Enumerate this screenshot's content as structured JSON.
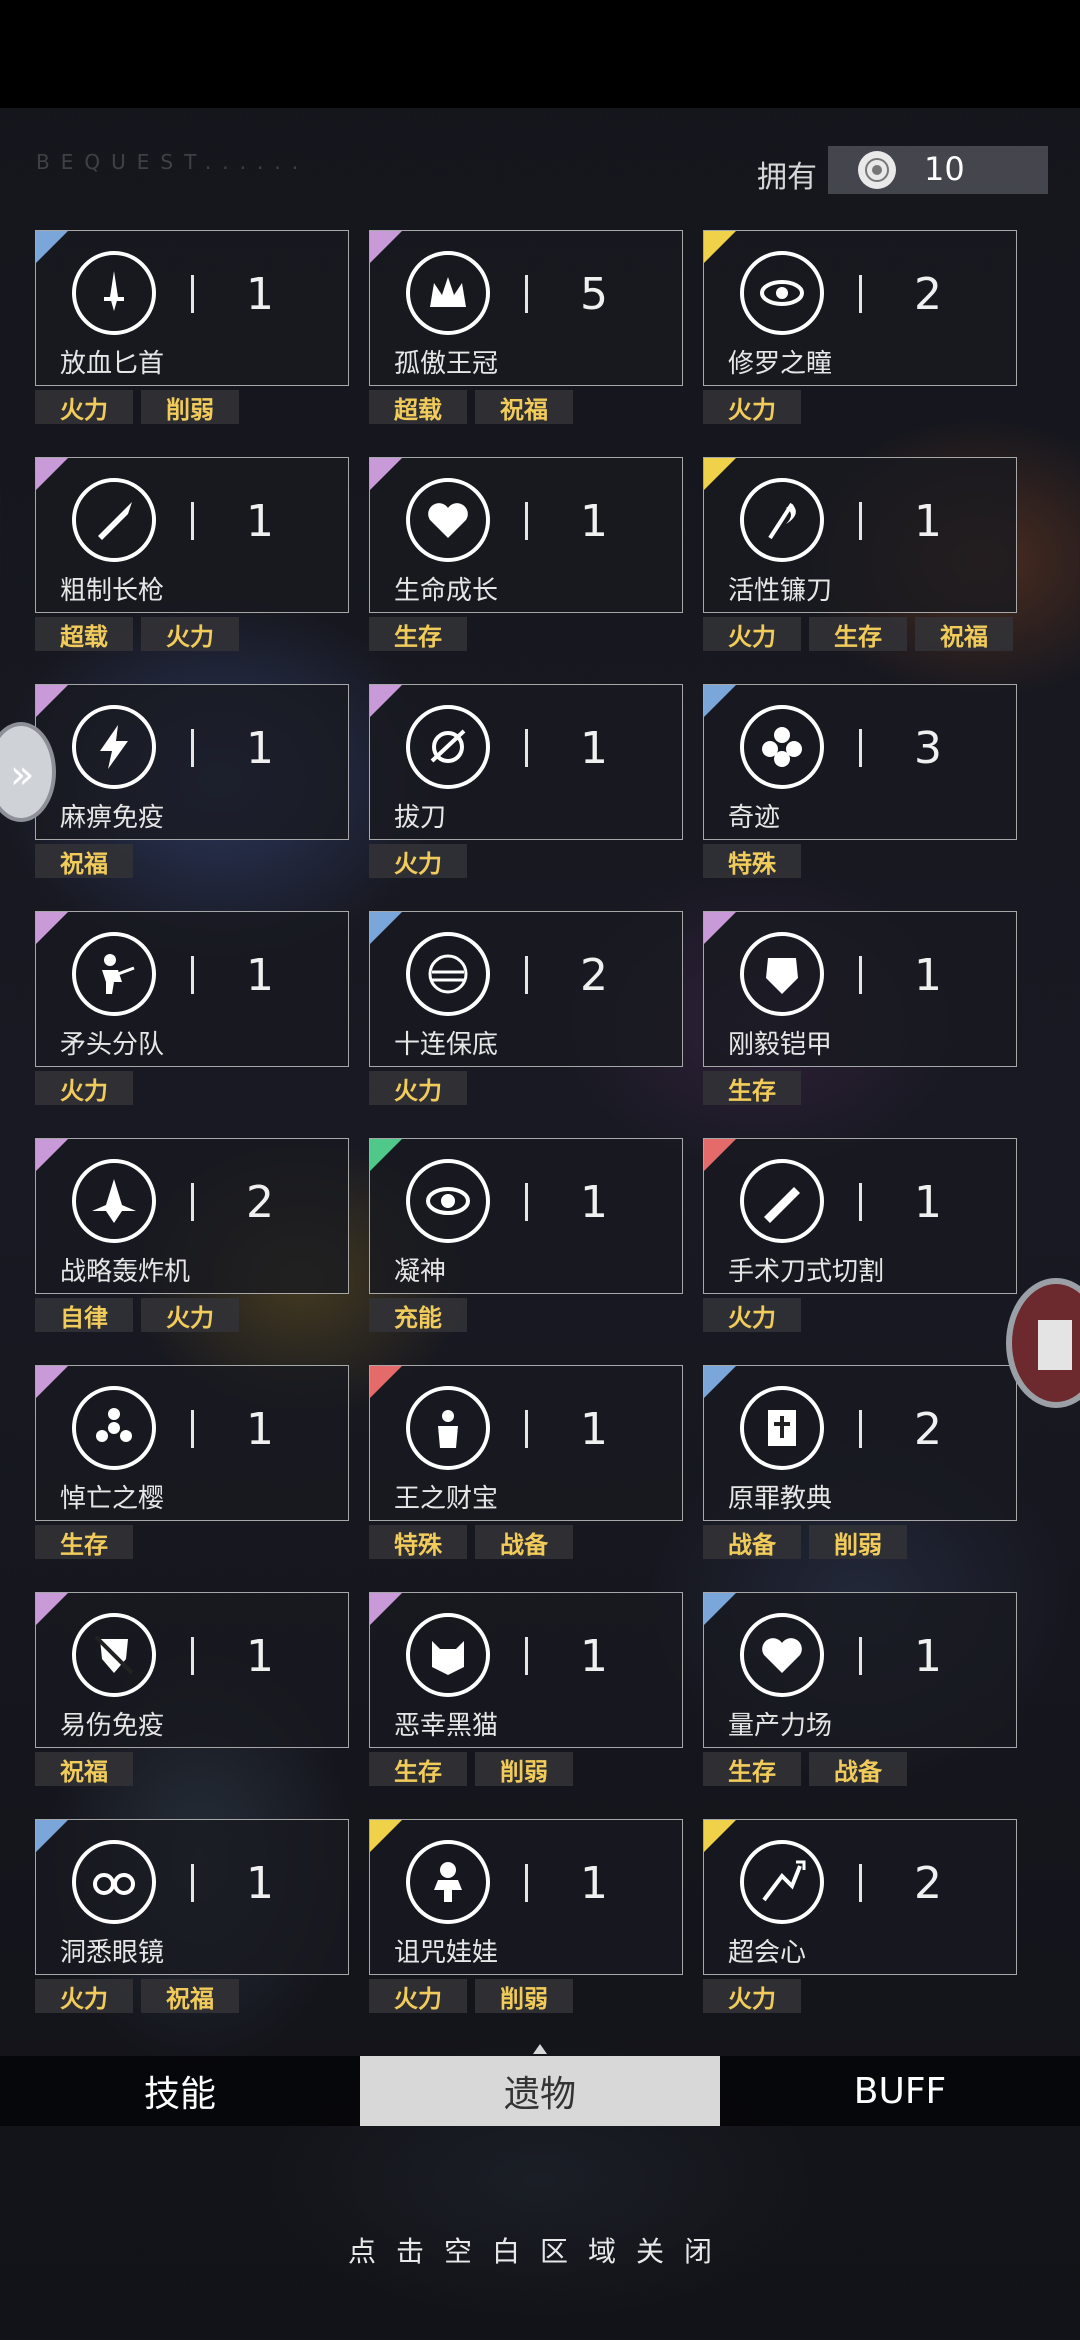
{
  "header": {
    "section_label": "BEQUEST......",
    "owned_label": "拥有",
    "owned_value": "10",
    "owned_icon": "coin-icon"
  },
  "relics": [
    {
      "name": "放血匕首",
      "count": "1",
      "rarity": "blue",
      "icon": "dagger-icon",
      "tags": [
        "火力",
        "削弱"
      ]
    },
    {
      "name": "孤傲王冠",
      "count": "5",
      "rarity": "purple",
      "icon": "crown-icon",
      "tags": [
        "超载",
        "祝福"
      ]
    },
    {
      "name": "修罗之瞳",
      "count": "2",
      "rarity": "yellow",
      "icon": "eye-icon",
      "tags": [
        "火力"
      ]
    },
    {
      "name": "粗制长枪",
      "count": "1",
      "rarity": "purple",
      "icon": "spear-icon",
      "tags": [
        "超载",
        "火力"
      ]
    },
    {
      "name": "生命成长",
      "count": "1",
      "rarity": "purple",
      "icon": "heart-icon",
      "tags": [
        "生存"
      ]
    },
    {
      "name": "活性镰刀",
      "count": "1",
      "rarity": "yellow",
      "icon": "scythe-icon",
      "tags": [
        "火力",
        "生存",
        "祝福"
      ]
    },
    {
      "name": "麻痹免疫",
      "count": "1",
      "rarity": "purple",
      "icon": "lightning-icon",
      "tags": [
        "祝福"
      ]
    },
    {
      "name": "拔刀",
      "count": "1",
      "rarity": "purple",
      "icon": "sword-draw-icon",
      "tags": [
        "火力"
      ]
    },
    {
      "name": "奇迹",
      "count": "3",
      "rarity": "blue",
      "icon": "flower-icon",
      "tags": [
        "特殊"
      ]
    },
    {
      "name": "矛头分队",
      "count": "1",
      "rarity": "purple",
      "icon": "soldier-icon",
      "tags": [
        "火力"
      ]
    },
    {
      "name": "十连保底",
      "count": "2",
      "rarity": "blue",
      "icon": "ten-pull-icon",
      "tags": [
        "火力"
      ]
    },
    {
      "name": "刚毅铠甲",
      "count": "1",
      "rarity": "purple",
      "icon": "armor-icon",
      "tags": [
        "生存"
      ]
    },
    {
      "name": "战略轰炸机",
      "count": "2",
      "rarity": "purple",
      "icon": "bomber-icon",
      "tags": [
        "自律",
        "火力"
      ]
    },
    {
      "name": "凝神",
      "count": "1",
      "rarity": "green",
      "icon": "focus-eye-icon",
      "tags": [
        "充能"
      ]
    },
    {
      "name": "手术刀式切割",
      "count": "1",
      "rarity": "red",
      "icon": "scalpel-icon",
      "tags": [
        "火力"
      ]
    },
    {
      "name": "悼亡之樱",
      "count": "1",
      "rarity": "purple",
      "icon": "sakura-icon",
      "tags": [
        "生存"
      ]
    },
    {
      "name": "王之财宝",
      "count": "1",
      "rarity": "red",
      "icon": "treasure-icon",
      "tags": [
        "特殊",
        "战备"
      ]
    },
    {
      "name": "原罪教典",
      "count": "2",
      "rarity": "blue",
      "icon": "book-icon",
      "tags": [
        "战备",
        "削弱"
      ]
    },
    {
      "name": "易伤免疫",
      "count": "1",
      "rarity": "purple",
      "icon": "crossed-shield-icon",
      "tags": [
        "祝福"
      ]
    },
    {
      "name": "恶幸黑猫",
      "count": "1",
      "rarity": "purple",
      "icon": "black-cat-icon",
      "tags": [
        "生存",
        "削弱"
      ]
    },
    {
      "name": "量产力场",
      "count": "1",
      "rarity": "blue",
      "icon": "force-field-icon",
      "tags": [
        "生存",
        "战备"
      ]
    },
    {
      "name": "洞悉眼镜",
      "count": "1",
      "rarity": "blue",
      "icon": "glasses-icon",
      "tags": [
        "火力",
        "祝福"
      ]
    },
    {
      "name": "诅咒娃娃",
      "count": "1",
      "rarity": "yellow",
      "icon": "voodoo-doll-icon",
      "tags": [
        "火力",
        "削弱"
      ]
    },
    {
      "name": "超会心",
      "count": "2",
      "rarity": "yellow",
      "icon": "crit-up-icon",
      "tags": [
        "火力"
      ]
    }
  ],
  "tabs": [
    {
      "label": "技能",
      "active": false
    },
    {
      "label": "遗物",
      "active": true
    },
    {
      "label": "BUFF",
      "active": false
    }
  ],
  "close_hint": "点击空白区域关闭"
}
